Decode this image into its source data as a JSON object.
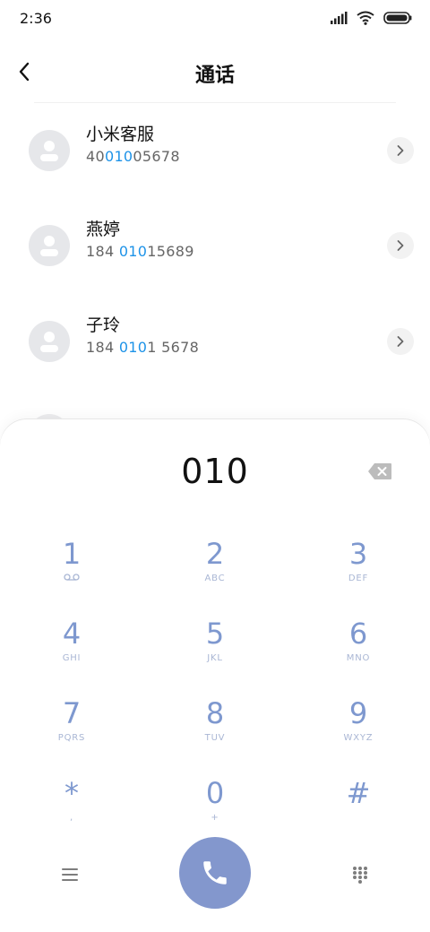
{
  "status_bar": {
    "time": "2:36"
  },
  "header": {
    "title": "通话"
  },
  "contacts": [
    {
      "name": "小米客服",
      "number_pre": "40",
      "number_match": "010",
      "number_post": "05678"
    },
    {
      "name": "燕婷",
      "number_pre": "184 ",
      "number_match": "010",
      "number_post": "15689"
    },
    {
      "name": "子玲",
      "number_pre": "184 ",
      "number_match": "010",
      "number_post": "1 5678"
    }
  ],
  "dialer": {
    "input": "010",
    "keys": [
      {
        "digit": "1",
        "sub": ""
      },
      {
        "digit": "2",
        "sub": "ABC"
      },
      {
        "digit": "3",
        "sub": "DEF"
      },
      {
        "digit": "4",
        "sub": "GHI"
      },
      {
        "digit": "5",
        "sub": "JKL"
      },
      {
        "digit": "6",
        "sub": "MNO"
      },
      {
        "digit": "7",
        "sub": "PQRS"
      },
      {
        "digit": "8",
        "sub": "TUV"
      },
      {
        "digit": "9",
        "sub": "WXYZ"
      },
      {
        "digit": "*",
        "sub": ","
      },
      {
        "digit": "0",
        "sub": "+"
      },
      {
        "digit": "#",
        "sub": ""
      }
    ]
  },
  "colors": {
    "accent": "#1e93e8",
    "key_digit": "#7e98cf",
    "call_button": "#8397cd"
  },
  "icons": {
    "voicemail": "voicemail-icon",
    "backspace": "backspace-icon",
    "menu": "menu-icon",
    "call": "phone-icon",
    "keypad": "keypad-icon"
  }
}
